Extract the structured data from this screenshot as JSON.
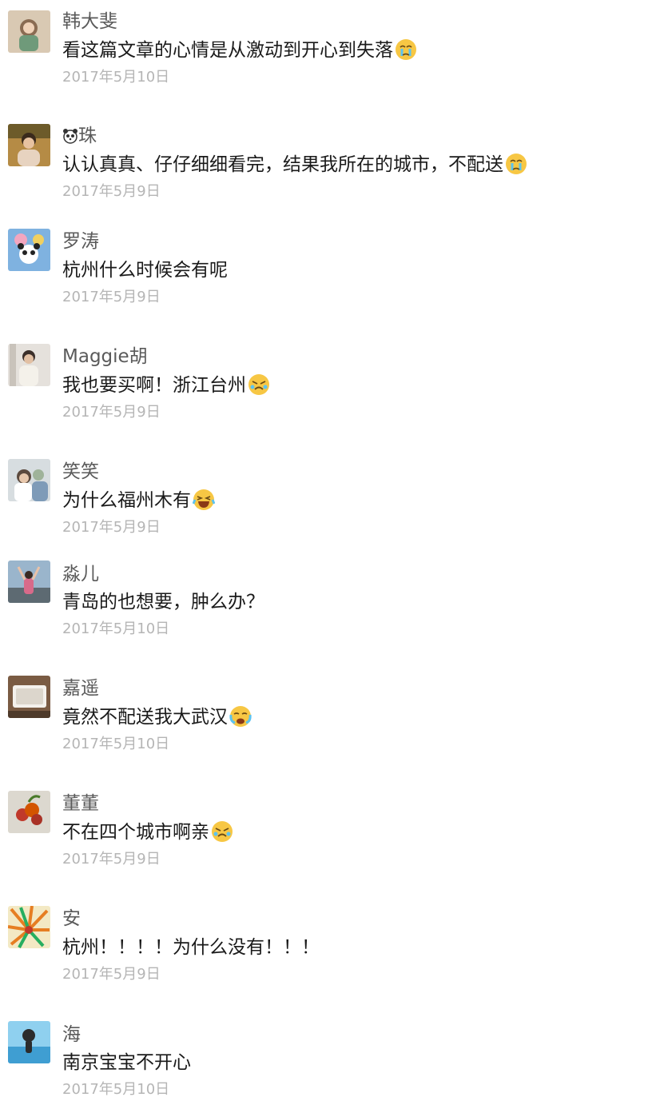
{
  "comments": [
    {
      "name": "韩大斐",
      "text": "看这篇文章的心情是从激动到开心到失落",
      "emoji": "crying-face-icon",
      "date": "2017年5月10日"
    },
    {
      "name": "珠",
      "name_icon": "panda-face-icon",
      "text": "认认真真、仔仔细细看完，结果我所在的城市，不配送",
      "emoji": "crying-face-icon",
      "date": "2017年5月9日"
    },
    {
      "name": "罗涛",
      "text": "杭州什么时候会有呢",
      "date": "2017年5月9日"
    },
    {
      "name": "Maggie胡",
      "text": "我也要买啊！浙江台州",
      "emoji": "sobbing-face-icon",
      "date": "2017年5月9日"
    },
    {
      "name": "笑笑",
      "text": "为什么福州木有",
      "emoji": "laughing-crying-face-icon",
      "date": "2017年5月9日"
    },
    {
      "name": "淼儿",
      "text": "青岛的也想要，肿么办？",
      "date": "2017年5月10日"
    },
    {
      "name": "嘉遥",
      "text": "竟然不配送我大武汉",
      "emoji": "loudly-crying-face-icon",
      "date": "2017年5月10日"
    },
    {
      "name": "董董",
      "text": "不在四个城市啊亲",
      "emoji": "sobbing-face-icon",
      "date": "2017年5月9日"
    },
    {
      "name": "安",
      "text": "杭州！！！！为什么没有！！！",
      "date": "2017年5月9日"
    },
    {
      "name": "海",
      "text": "南京宝宝不开心",
      "date": "2017年5月10日"
    }
  ]
}
